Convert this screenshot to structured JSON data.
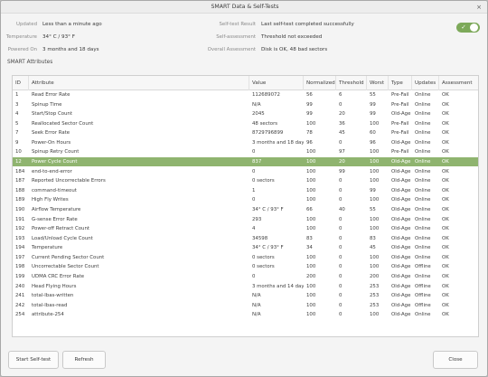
{
  "window": {
    "title": "SMART Data & Self-Tests",
    "close_glyph": "×"
  },
  "info": {
    "updated_label": "Updated",
    "updated_value": "Less than a minute ago",
    "temperature_label": "Temperature",
    "temperature_value": "34° C / 93° F",
    "powered_on_label": "Powered On",
    "powered_on_value": "3 months and 18 days",
    "selftest_label": "Self-test Result",
    "selftest_value": "Last self-test completed successfully",
    "selfassessment_label": "Self-assessment",
    "selfassessment_value": "Threshold not exceeded",
    "overall_label": "Overall Assessment",
    "overall_value": "Disk is OK, 48 bad sectors"
  },
  "toggle": {
    "state": "on",
    "check_glyph": "✓",
    "color": "#7da95a"
  },
  "smart": {
    "heading": "SMART Attributes",
    "columns": [
      "ID",
      "Attribute",
      "Value",
      "Normalized",
      "Threshold",
      "Worst",
      "Type",
      "Updates",
      "Assessment"
    ],
    "selected_color": "#8fb46f",
    "rows": [
      [
        "1",
        "Read Error Rate",
        "112689072",
        "56",
        "6",
        "55",
        "Pre-Fail",
        "Online",
        "OK"
      ],
      [
        "3",
        "Spinup Time",
        "N/A",
        "99",
        "0",
        "99",
        "Pre-Fail",
        "Online",
        "OK"
      ],
      [
        "4",
        "Start/Stop Count",
        "2045",
        "99",
        "20",
        "99",
        "Old-Age",
        "Online",
        "OK"
      ],
      [
        "5",
        "Reallocated Sector Count",
        "48 sectors",
        "100",
        "36",
        "100",
        "Pre-Fail",
        "Online",
        "OK"
      ],
      [
        "7",
        "Seek Error Rate",
        "8729796899",
        "78",
        "45",
        "60",
        "Pre-Fail",
        "Online",
        "OK"
      ],
      [
        "9",
        "Power-On Hours",
        "3 months and 18 days",
        "96",
        "0",
        "96",
        "Old-Age",
        "Online",
        "OK"
      ],
      [
        "10",
        "Spinup Retry Count",
        "0",
        "100",
        "97",
        "100",
        "Pre-Fail",
        "Online",
        "OK"
      ],
      [
        "12",
        "Power Cycle Count",
        "837",
        "100",
        "20",
        "100",
        "Old-Age",
        "Online",
        "OK"
      ],
      [
        "184",
        "end-to-end-error",
        "0",
        "100",
        "99",
        "100",
        "Old-Age",
        "Online",
        "OK"
      ],
      [
        "187",
        "Reported Uncorrectable Errors",
        "0 sectors",
        "100",
        "0",
        "100",
        "Old-Age",
        "Online",
        "OK"
      ],
      [
        "188",
        "command-timeout",
        "1",
        "100",
        "0",
        "99",
        "Old-Age",
        "Online",
        "OK"
      ],
      [
        "189",
        "High Fly Writes",
        "0",
        "100",
        "0",
        "100",
        "Old-Age",
        "Online",
        "OK"
      ],
      [
        "190",
        "Airflow Temperature",
        "34° C / 93° F",
        "66",
        "40",
        "55",
        "Old-Age",
        "Online",
        "OK"
      ],
      [
        "191",
        "G-sense Error Rate",
        "293",
        "100",
        "0",
        "100",
        "Old-Age",
        "Online",
        "OK"
      ],
      [
        "192",
        "Power-off Retract Count",
        "4",
        "100",
        "0",
        "100",
        "Old-Age",
        "Online",
        "OK"
      ],
      [
        "193",
        "Load/Unload Cycle Count",
        "34598",
        "83",
        "0",
        "83",
        "Old-Age",
        "Online",
        "OK"
      ],
      [
        "194",
        "Temperature",
        "34° C / 93° F",
        "34",
        "0",
        "45",
        "Old-Age",
        "Online",
        "OK"
      ],
      [
        "197",
        "Current Pending Sector Count",
        "0 sectors",
        "100",
        "0",
        "100",
        "Old-Age",
        "Online",
        "OK"
      ],
      [
        "198",
        "Uncorrectable Sector Count",
        "0 sectors",
        "100",
        "0",
        "100",
        "Old-Age",
        "Offline",
        "OK"
      ],
      [
        "199",
        "UDMA CRC Error Rate",
        "0",
        "200",
        "0",
        "200",
        "Old-Age",
        "Online",
        "OK"
      ],
      [
        "240",
        "Head Flying Hours",
        "3 months and 14 days",
        "100",
        "0",
        "253",
        "Old-Age",
        "Offline",
        "OK"
      ],
      [
        "241",
        "total-lbas-written",
        "N/A",
        "100",
        "0",
        "253",
        "Old-Age",
        "Offline",
        "OK"
      ],
      [
        "242",
        "total-lbas-read",
        "N/A",
        "100",
        "0",
        "253",
        "Old-Age",
        "Offline",
        "OK"
      ],
      [
        "254",
        "attribute-254",
        "N/A",
        "100",
        "0",
        "100",
        "Old-Age",
        "Online",
        "OK"
      ]
    ]
  },
  "footer": {
    "start_selftest_label": "Start Self-test",
    "refresh_label": "Refresh",
    "close_label": "Close"
  }
}
